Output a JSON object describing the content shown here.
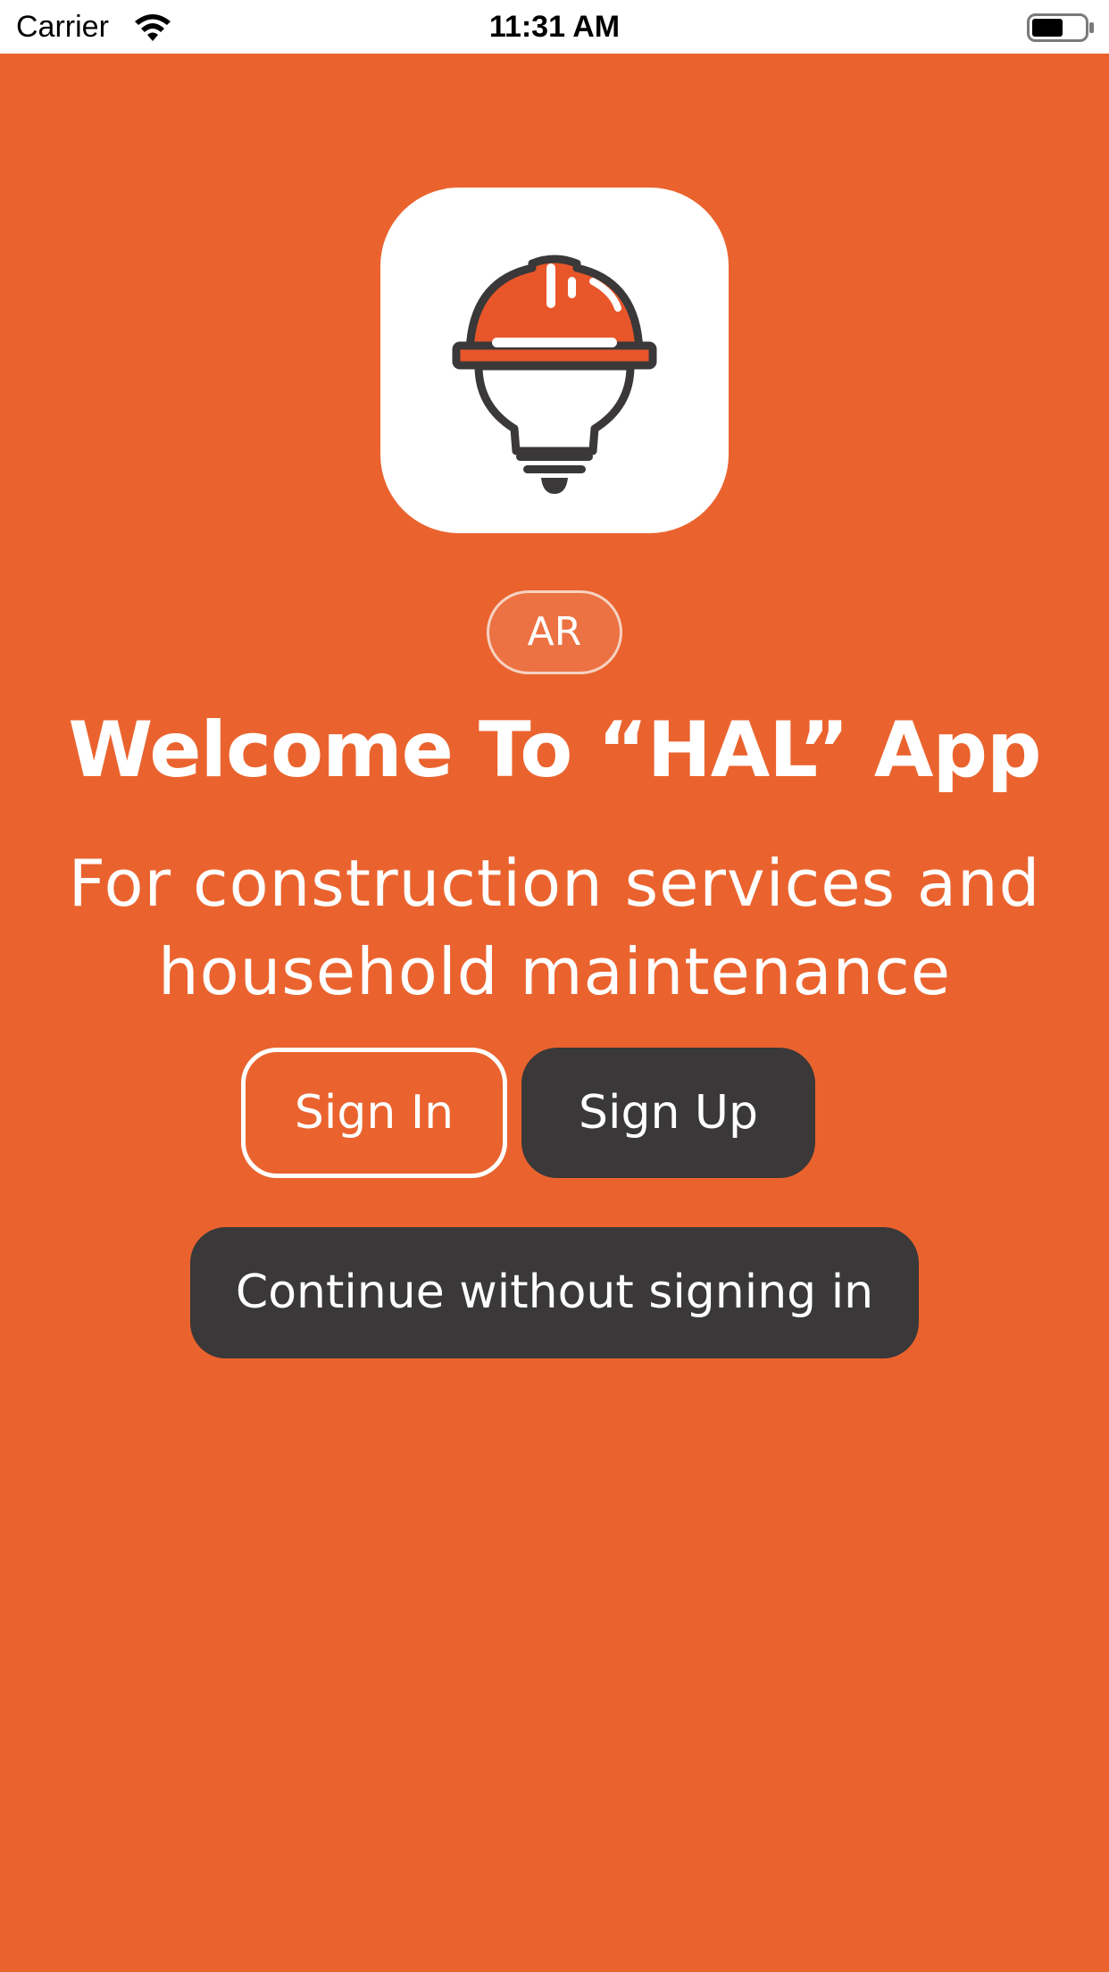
{
  "status_bar": {
    "carrier": "Carrier",
    "time": "11:31 AM",
    "battery_level": 0.6
  },
  "logo": {
    "icon": "hard-hat-lightbulb-icon",
    "helmet_color": "#E8562A",
    "stroke_color": "#3A3839"
  },
  "language_toggle": {
    "label": "AR"
  },
  "welcome": {
    "title": "Welcome To “HAL” App",
    "subtitle_line1": "For construction services and",
    "subtitle_line2": "household maintenance"
  },
  "actions": {
    "sign_in_label": "Sign In",
    "sign_up_label": "Sign Up",
    "guest_label": "Continue without signing in"
  },
  "colors": {
    "background": "#EA632E",
    "dark_button": "#3A3839",
    "text": "#FFFFFF"
  }
}
